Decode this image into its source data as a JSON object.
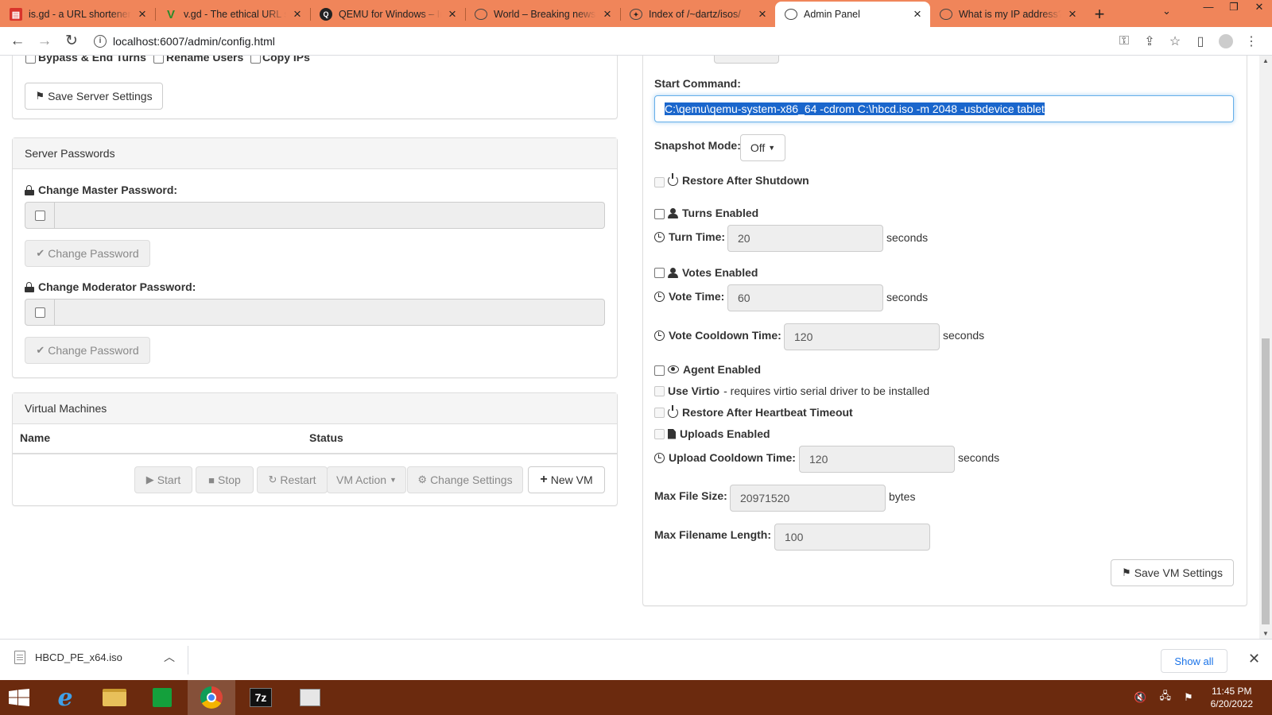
{
  "browser": {
    "tabs": [
      {
        "title": "is.gd - a URL shortener. Make URLs shorter",
        "favicon": "isgd-icon",
        "active": false
      },
      {
        "title": "v.gd - The ethical URL shortener",
        "favicon": "vgd-icon",
        "active": false
      },
      {
        "title": "QEMU for Windows – Installers",
        "favicon": "qemu-icon",
        "active": false
      },
      {
        "title": "World – Breaking news",
        "favicon": "globe-icon",
        "active": false
      },
      {
        "title": "Index of /~dartz/isos/",
        "favicon": "index-icon",
        "active": false
      },
      {
        "title": "Admin Panel",
        "favicon": "globe-icon",
        "active": true
      },
      {
        "title": "What is my IP address?",
        "favicon": "globe-icon",
        "active": false
      }
    ],
    "url": "localhost:6007/admin/config.html"
  },
  "left": {
    "top_options": [
      "Bypass & End Turns",
      "Rename Users",
      "Copy IPs"
    ],
    "save_server_label": "Save Server Settings",
    "passwords": {
      "heading": "Server Passwords",
      "master_label": "Change Master Password:",
      "moderator_label": "Change Moderator Password:",
      "change_label": "Change Password"
    },
    "vms": {
      "heading": "Virtual Machines",
      "columns": [
        "Name",
        "Status"
      ],
      "buttons": {
        "start": "Start",
        "stop": "Stop",
        "restart": "Restart",
        "vm_action": "VM Action",
        "change_settings": "Change Settings",
        "new_vm": "New VM"
      }
    }
  },
  "right": {
    "start_command_label": "Start Command:",
    "start_command_value": "C:\\qemu\\qemu-system-x86_64 -cdrom C:\\hbcd.iso -m 2048 -usbdevice tablet",
    "snapshot_label": "Snapshot Mode:",
    "snapshot_value": "Off",
    "restore_shutdown": "Restore After Shutdown",
    "turns_enabled": "Turns Enabled",
    "turn_time_label": "Turn Time:",
    "turn_time_value": "20",
    "votes_enabled": "Votes Enabled",
    "vote_time_label": "Vote Time:",
    "vote_time_value": "60",
    "vote_cooldown_label": "Vote Cooldown Time:",
    "vote_cooldown_value": "120",
    "seconds": "seconds",
    "agent_enabled": "Agent Enabled",
    "use_virtio": "Use Virtio",
    "use_virtio_note": " - requires virtio serial driver to be installed",
    "restore_heartbeat": "Restore After Heartbeat Timeout",
    "uploads_enabled": "Uploads Enabled",
    "upload_cooldown_label": "Upload Cooldown Time:",
    "upload_cooldown_value": "120",
    "max_file_size_label": "Max File Size:",
    "max_file_size_value": "20971520",
    "bytes": "bytes",
    "max_filename_label": "Max Filename Length:",
    "max_filename_value": "100",
    "save_vm_label": "Save VM Settings"
  },
  "downloads": {
    "file": "HBCD_PE_x64.iso",
    "show_all": "Show all"
  },
  "taskbar": {
    "time": "11:45 PM",
    "date": "6/20/2022"
  }
}
